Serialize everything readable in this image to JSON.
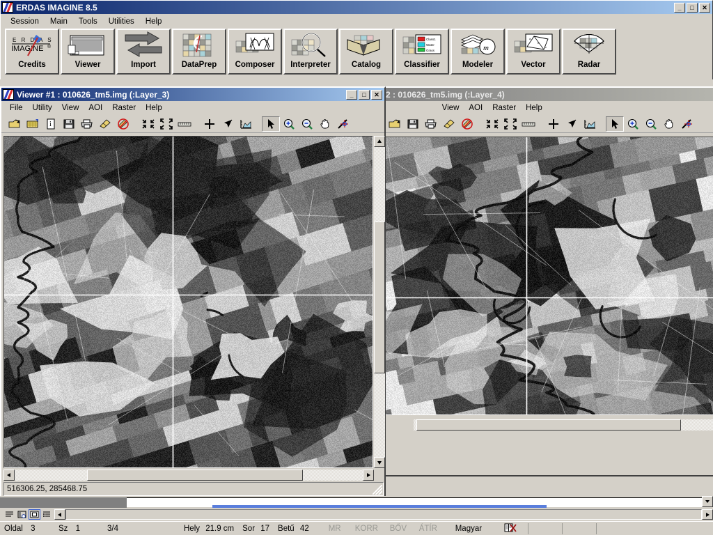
{
  "app": {
    "title": "ERDAS IMAGINE 8.5",
    "icon": "erdas-logo-icon",
    "window_buttons": {
      "minimize": "_",
      "maximize": "□",
      "close": "✕"
    },
    "menu": [
      "Session",
      "Main",
      "Tools",
      "Utilities",
      "Help"
    ],
    "icon_panel": [
      {
        "label": "Credits",
        "icon": "erdas-imagine-credits-icon"
      },
      {
        "label": "Viewer",
        "icon": "viewer-window-icon"
      },
      {
        "label": "Import",
        "icon": "import-export-arrows-icon"
      },
      {
        "label": "DataPrep",
        "icon": "dataprep-grid-icon"
      },
      {
        "label": "Composer",
        "icon": "composer-map-icon"
      },
      {
        "label": "Interpreter",
        "icon": "interpreter-magnifier-icon"
      },
      {
        "label": "Catalog",
        "icon": "catalog-open-book-icon"
      },
      {
        "label": "Classifier",
        "icon": "classifier-legend-icon"
      },
      {
        "label": "Modeler",
        "icon": "modeler-layers-icon"
      },
      {
        "label": "Vector",
        "icon": "vector-polygon-icon"
      },
      {
        "label": "Radar",
        "icon": "radar-fan-icon"
      }
    ]
  },
  "viewer1": {
    "title": "Viewer #1 : 010626_tm5.img (:Layer_3)",
    "active": true,
    "window_buttons": {
      "minimize": "_",
      "maximize": "□",
      "close": "✕"
    },
    "menu": [
      "File",
      "Utility",
      "View",
      "AOI",
      "Raster",
      "Help"
    ],
    "toolbar": [
      "open-file-icon",
      "open-layer-icon",
      "image-info-icon",
      "save-icon",
      "print-icon",
      "erase-icon",
      "clear-no-icon",
      "zoom-in-extent-icon",
      "fit-to-window-icon",
      "measure-ruler-icon",
      "inquire-cursor-icon",
      "select-arrow-tool-icon",
      "profile-chart-icon",
      "pointer-select-icon",
      "zoom-in-icon",
      "zoom-out-icon",
      "pan-hand-icon",
      "link-cursor-icon"
    ],
    "selected_tool": "pointer-select-icon",
    "status_text": "516306.25, 285468.75"
  },
  "viewer2": {
    "title": "2 : 010626_tm5.img (:Layer_4)",
    "active": false,
    "menu": [
      "View",
      "AOI",
      "Raster",
      "Help"
    ],
    "toolbar": [
      "open-file-icon",
      "save-icon",
      "print-icon",
      "erase-icon",
      "clear-no-icon",
      "zoom-in-extent-icon",
      "fit-to-window-icon",
      "measure-ruler-icon",
      "inquire-cursor-icon",
      "select-arrow-tool-icon",
      "profile-chart-icon",
      "pointer-select-icon",
      "zoom-in-icon",
      "zoom-out-icon",
      "pan-hand-icon",
      "link-cursor-icon"
    ],
    "selected_tool": "pointer-select-icon"
  },
  "word_status": {
    "page_label": "Oldal",
    "page_value": "3",
    "section_label": "Sz",
    "section_value": "1",
    "page_of": "3/4",
    "pos_label": "Hely",
    "pos_value": "21.9 cm",
    "line_label": "Sor",
    "line_value": "17",
    "col_label": "Betű",
    "col_value": "42",
    "modes": [
      "MR",
      "KORR",
      "BŐV",
      "ÁTÍR"
    ],
    "language": "Magyar",
    "spellcheck_icon": "spellcheck-error-icon",
    "view_buttons": [
      "normal-view-icon",
      "web-layout-view-icon",
      "print-layout-view-icon",
      "outline-view-icon"
    ],
    "active_view": "print-layout-view-icon"
  },
  "colors": {
    "face": "#d4d0c8",
    "title_active_start": "#0a246a",
    "title_active_end": "#a6caf0",
    "title_inactive_start": "#808080",
    "title_inactive_end": "#b5b5ae",
    "desktop": "#c8c4bc",
    "word_accent": "#5a7edc"
  }
}
